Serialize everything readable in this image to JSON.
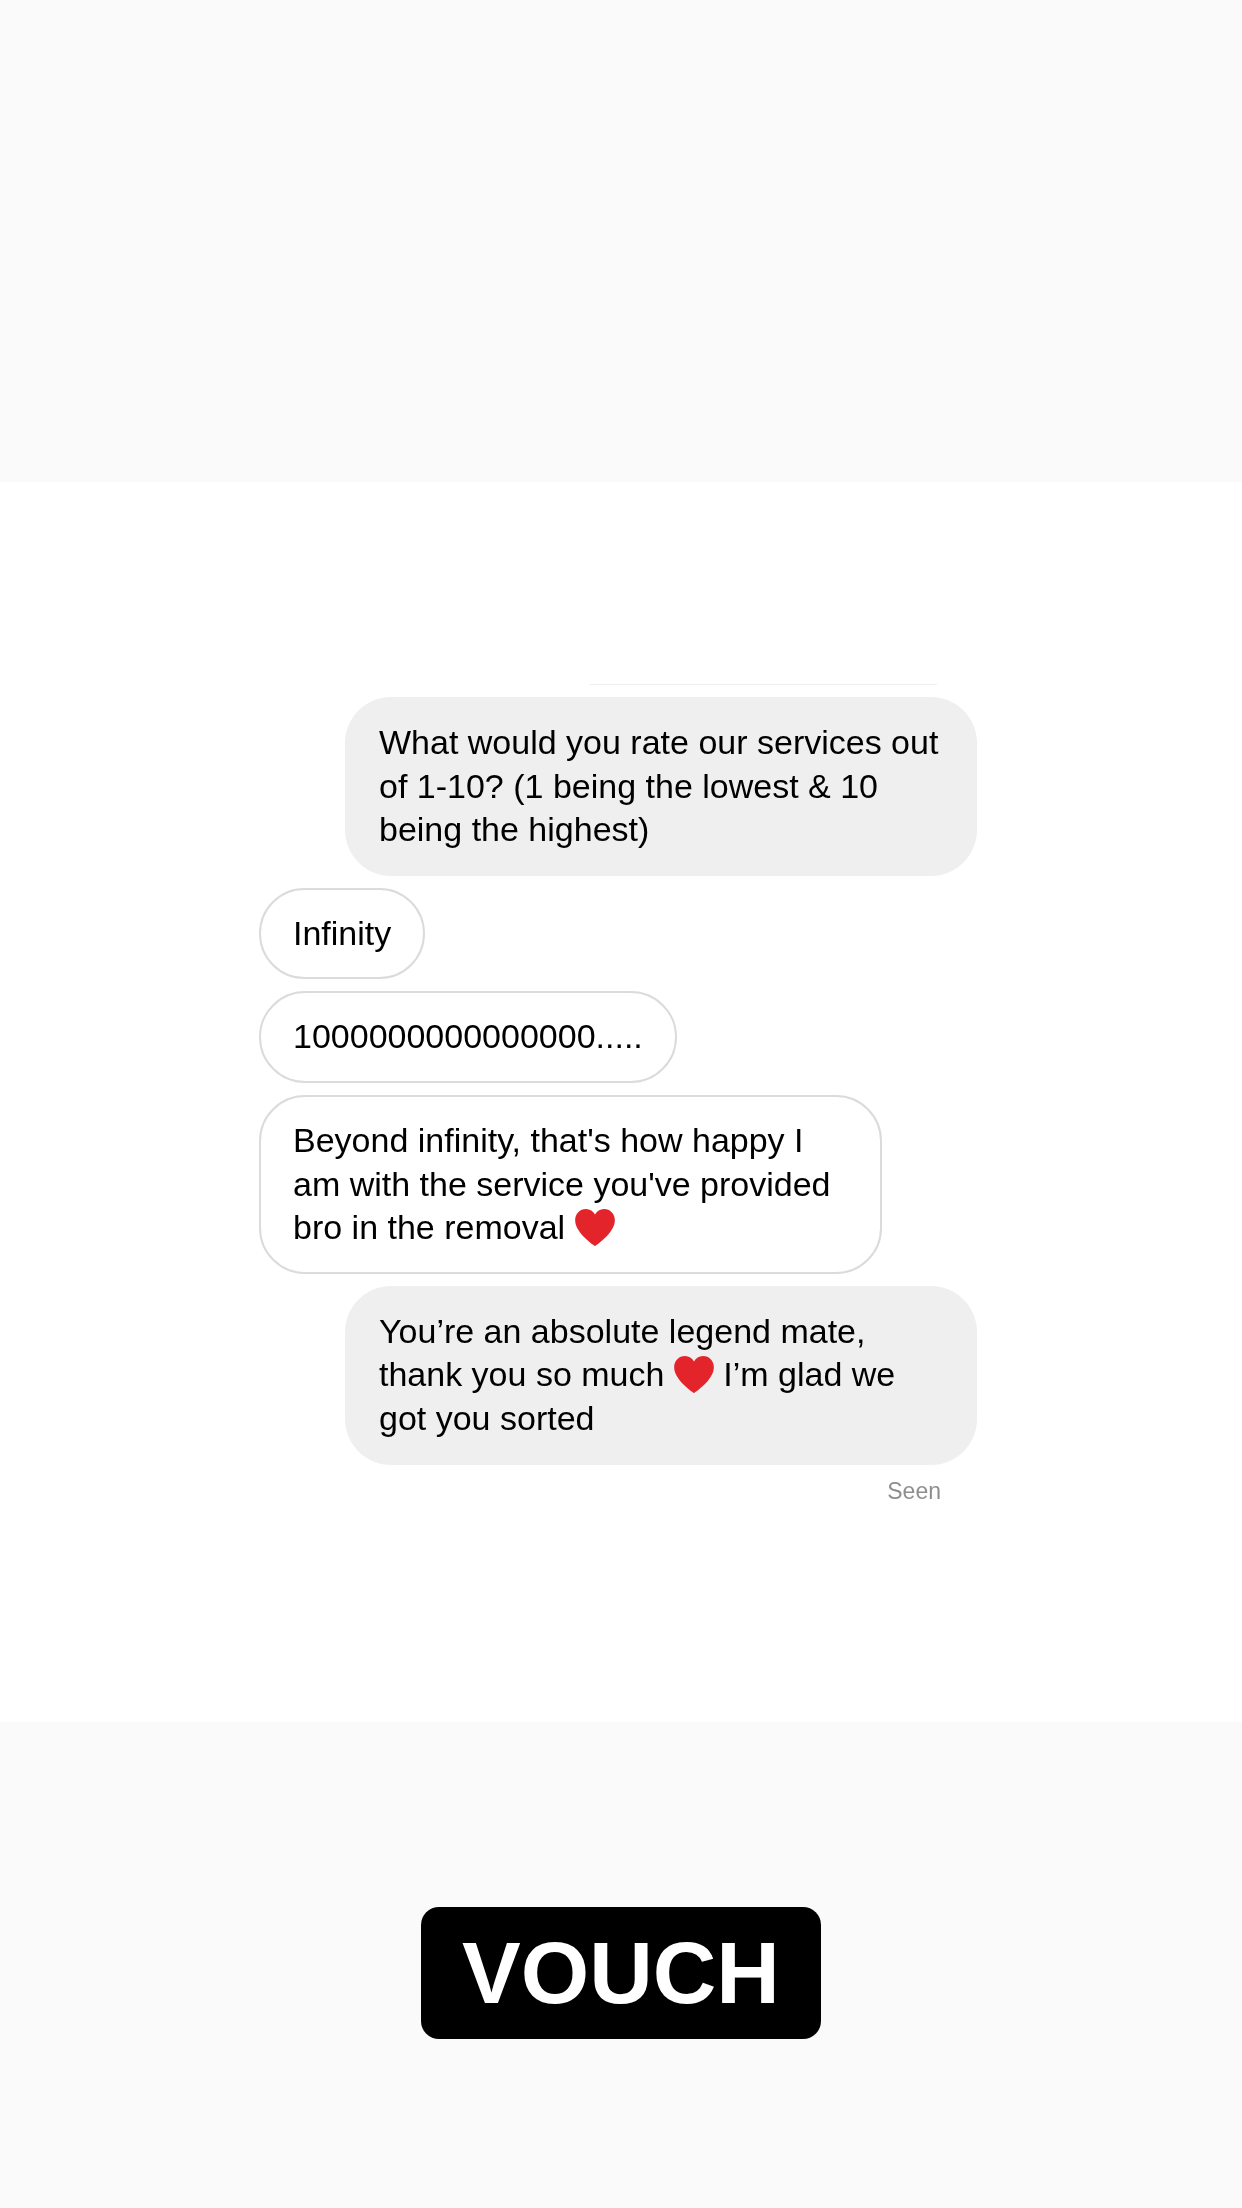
{
  "messages": [
    {
      "kind": "sent",
      "parts": [
        {
          "kind": "text",
          "text": "What would you rate our services out of 1-10? (1 being the lowest & 10 being the highest)"
        }
      ]
    },
    {
      "kind": "received",
      "parts": [
        {
          "kind": "text",
          "text": "Infinity"
        }
      ]
    },
    {
      "kind": "received",
      "parts": [
        {
          "kind": "text",
          "text": "1000000000000000....."
        }
      ]
    },
    {
      "kind": "received",
      "parts": [
        {
          "kind": "text",
          "text": "Beyond infinity, that's how happy I am with the service you've provided bro in the removal"
        },
        {
          "kind": "heart"
        }
      ]
    },
    {
      "kind": "sent",
      "parts": [
        {
          "kind": "text",
          "text": "You’re an absolute legend mate, thank you so much"
        },
        {
          "kind": "heart"
        },
        {
          "kind": "text",
          "text": "I’m glad we got you sorted"
        }
      ]
    }
  ],
  "seen_label": "Seen",
  "stamp_label": "VOUCH"
}
